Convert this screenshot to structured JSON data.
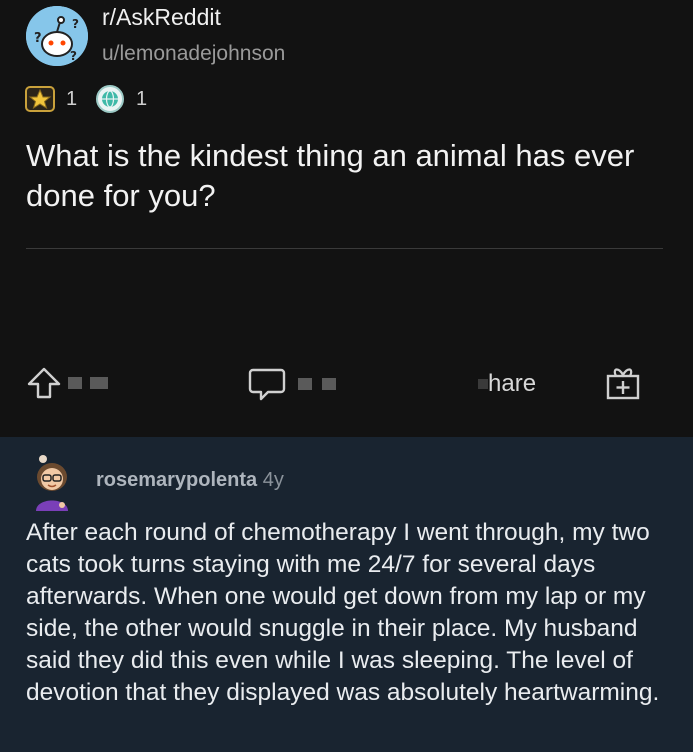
{
  "post": {
    "subreddit": "r/AskReddit",
    "author": "u/lemonadejohnson",
    "awards": [
      {
        "icon": "gold-star-award-icon",
        "count": "1"
      },
      {
        "icon": "globe-award-icon",
        "count": "1"
      }
    ],
    "title": "What is the kindest thing an animal has ever done for you?",
    "actions": {
      "share_label": "hare"
    }
  },
  "comment": {
    "username": "rosemarypolenta",
    "age": "4y",
    "body": "After each round of chemotherapy I went through, my two cats took turns staying with me 24/7 for several days afterwards. When one would get down from my lap or my side, the other would snuggle in their place. My husband said they did this even while I was sleeping. The level of devotion that they displayed was absolutely heartwarming."
  },
  "colors": {
    "post_bg": "#121212",
    "comment_bg": "#192430",
    "subreddit_avatar_bg": "#86c6ea",
    "comment_avatar_shirt": "#7a3fb8"
  }
}
